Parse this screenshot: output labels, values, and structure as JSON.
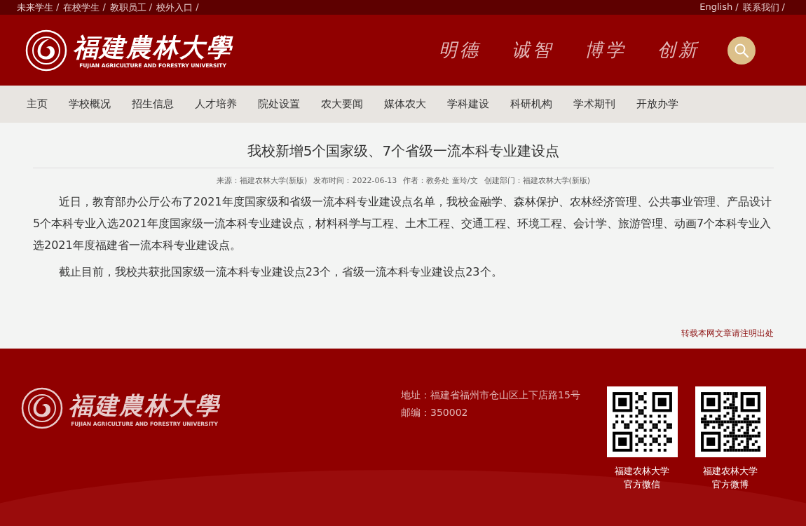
{
  "top_bar": {
    "separator": "/",
    "left_links": [
      {
        "label": "未来学生"
      },
      {
        "label": "在校学生"
      },
      {
        "label": "教职员工"
      },
      {
        "label": "校外入口"
      }
    ],
    "right_links": [
      {
        "label": "English"
      },
      {
        "label": "联系我们"
      }
    ]
  },
  "header": {
    "logo": {
      "name": "福建農林大學",
      "english": "FUJIAN AGRICULTURE AND FORESTRY UNIVERSITY"
    },
    "motto": [
      "明德",
      "诚智",
      "博学",
      "创新"
    ]
  },
  "nav": [
    {
      "label": "主页"
    },
    {
      "label": "学校概况"
    },
    {
      "label": "招生信息"
    },
    {
      "label": "人才培养"
    },
    {
      "label": "院处设置"
    },
    {
      "label": "农大要闻"
    },
    {
      "label": "媒体农大"
    },
    {
      "label": "学科建设"
    },
    {
      "label": "科研机构"
    },
    {
      "label": "学术期刊"
    },
    {
      "label": "开放办学"
    }
  ],
  "article": {
    "title": "我校新增5个国家级、7个省级一流本科专业建设点",
    "meta": [
      "来源：福建农林大学(新版)",
      "发布时间：2022-06-13",
      "作者：教务处 童玲/文",
      "创建部门：福建农林大学(新版)"
    ],
    "paragraphs": [
      "近日，教育部办公厅公布了2021年度国家级和省级一流本科专业建设点名单，我校金融学、森林保护、农林经济管理、公共事业管理、产品设计5个本科专业入选2021年度国家级一流本科专业建设点，材料科学与工程、土木工程、交通工程、环境工程、会计学、旅游管理、动画7个本科专业入选2021年度福建省一流本科专业建设点。",
      "截止目前，我校共获批国家级一流本科专业建设点23个，省级一流本科专业建设点23个。"
    ],
    "notice": "转载本网文章请注明出处"
  },
  "footer": {
    "logo": {
      "name": "福建農林大學",
      "english": "FUJIAN AGRICULTURE AND FORESTRY UNIVERSITY"
    },
    "address": [
      "地址：福建省福州市仓山区上下店路15号",
      "邮编：350002"
    ],
    "qr_codes": [
      {
        "caption": [
          "福建农林大学",
          "官方微信"
        ]
      },
      {
        "caption": [
          "福建农林大学",
          "官方微博"
        ]
      }
    ]
  }
}
